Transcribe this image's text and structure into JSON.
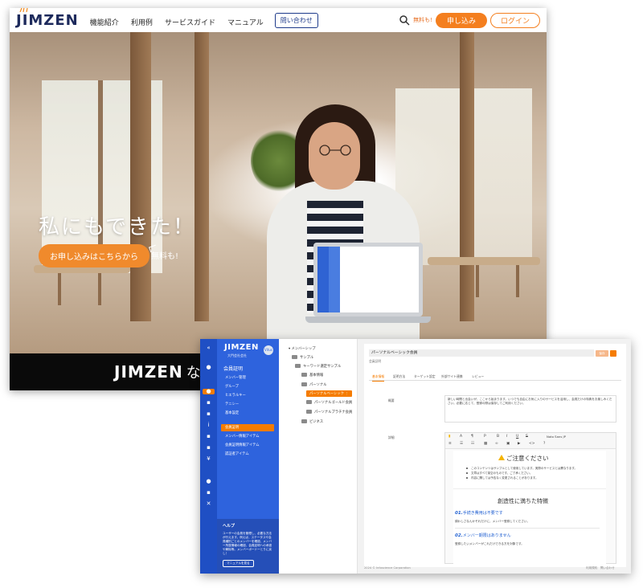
{
  "site": {
    "logo": "JIMZEN",
    "nav": [
      "機能紹介",
      "利用例",
      "サービスガイド",
      "マニュアル"
    ],
    "contact_button": "問い合わせ",
    "free_tag": "無料も!",
    "apply_button": "申し込み",
    "login_button": "ログイン",
    "hero_tagline": "私にもできた！",
    "hero_cta": "お申し込みはこちらから",
    "hero_free": "無料も!",
    "footer_logo": "JIMZEN",
    "footer_text": "な"
  },
  "app": {
    "logo": "JIMZEN",
    "context": "大門会社会社",
    "avatar": "Vitus",
    "rail_collapse": "«",
    "section_title": "会員証明",
    "sidebar_items": [
      "メンバー管理",
      "グループ",
      "ヒエラルキー",
      "テニシー",
      "基本設定",
      "会員証明",
      "メンバー情報アイテム",
      "会員証明情報アイテム",
      "認証者アイテム"
    ],
    "active_item_index": 5,
    "help": {
      "title": "ヘルプ",
      "text": "ユーザーの会員を管理し、必要な方法が行えます。例えば、ステータスや会員種別ごとのメンバーを確認、メンバー所属情報の確認、会員証明への承認や解除等。メンバーボードーとりに戻し！",
      "button": "マニュアルを見る"
    },
    "tree": {
      "root": "メンバーシップ",
      "nodes": [
        {
          "label": "サンプル",
          "level": 1
        },
        {
          "label": "キーワード選定サンプル",
          "level": 2
        },
        {
          "label": "基本情報",
          "level": 3
        },
        {
          "label": "パーソナル",
          "level": 3
        },
        {
          "label": "パーソナルベーシック",
          "level": 4,
          "selected": true
        },
        {
          "label": "パーソナルゴールド会員",
          "level": 4
        },
        {
          "label": "パーソナルプラチナ会員",
          "level": 4
        },
        {
          "label": "ビジネス",
          "level": 3
        }
      ]
    },
    "main": {
      "title_value": "パーソナルベーシック会員",
      "title_sub": "会員証明",
      "save_button": "保存",
      "tabs": [
        "基本情報",
        "証明方法",
        "ターゲット設定",
        "外部サイト連携",
        "レビュー"
      ],
      "active_tab": 0,
      "summary_label": "概要",
      "summary_text": "新しい時間と出会いが、ここから始まります。いつでも自由にお気に入りのサービスを活用し、会員だけの特典をお楽しみください。必要に応じて、登録の際は保存してご利用ください。",
      "detail_label": "詳細",
      "toolbar_font": "Noto Sans JP",
      "notice_title": "ご注意ください",
      "notice_items": [
        "このコンテンツはサンプルとして使用しています。実際のサービスとは異なります。",
        "文章はすべて架空のものです。ご了承ください。",
        "内容に関しては予告なく変更されることがあります。"
      ],
      "feature_title": "創造性に満ちた特徴",
      "features": [
        {
          "num": "01.",
          "title": "手続き費用は不要です",
          "text": "煩わしさなんかそれだけに、メンバー登録してください。"
        },
        {
          "num": "02.",
          "title": "メンバー期限はありません",
          "text": "登録したいメンバーがこれだけできる方を対象です。"
        }
      ]
    },
    "footer": "2024 © Infoscience Corporation",
    "footer_links": [
      "利用規約",
      "問い合わせ"
    ]
  }
}
